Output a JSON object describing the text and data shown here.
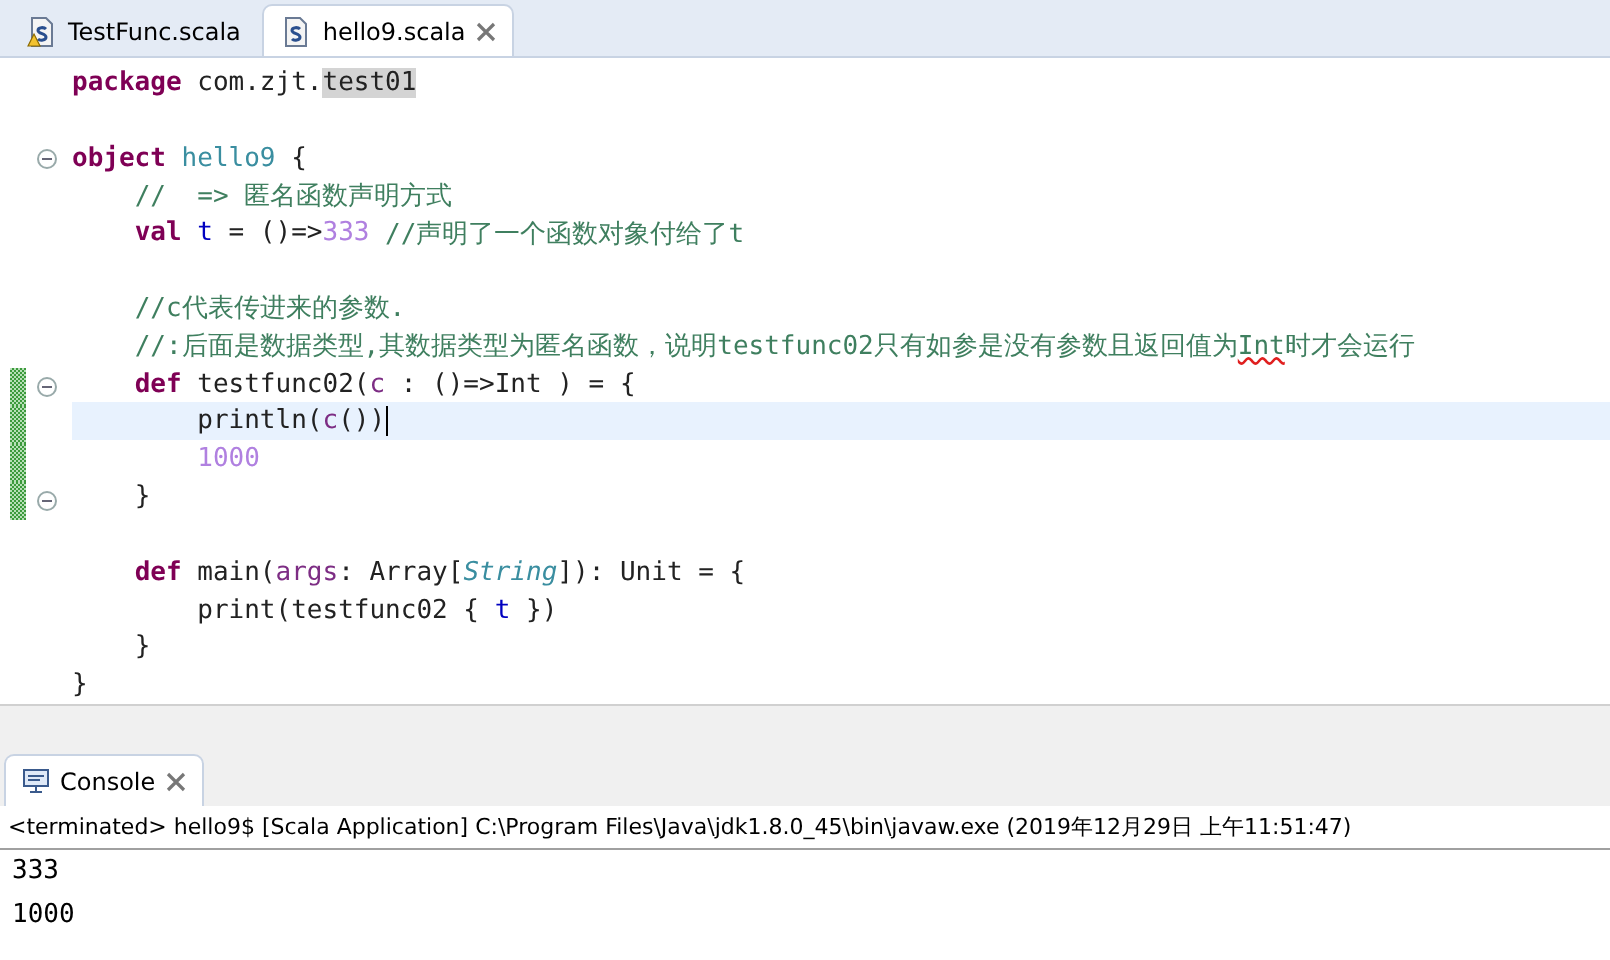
{
  "editor_tabs": [
    {
      "label": "TestFunc.scala",
      "selected": false,
      "warning": true,
      "closable": false
    },
    {
      "label": "hello9.scala",
      "selected": true,
      "warning": false,
      "closable": true
    }
  ],
  "code_lines": [
    {
      "kind": "code",
      "fold": false,
      "changed": false,
      "current": false,
      "tokens": [
        {
          "kind": "keyword",
          "text": "package"
        },
        {
          "kind": "plain",
          "text": " com.zjt."
        },
        {
          "kind": "occurrence",
          "text": "test01"
        }
      ]
    },
    {
      "kind": "blank"
    },
    {
      "kind": "code",
      "fold": true,
      "changed": false,
      "current": false,
      "tokens": [
        {
          "kind": "keyword",
          "text": "object"
        },
        {
          "kind": "object",
          "text": " hello9"
        },
        {
          "kind": "plain",
          "text": " {"
        }
      ],
      "children": [
        {
          "kind": "code",
          "fold": false,
          "changed": false,
          "current": false,
          "tokens": [
            {
              "kind": "comment",
              "text": "//  => 匿名函数声明方式"
            }
          ]
        },
        {
          "kind": "code",
          "fold": false,
          "changed": false,
          "current": false,
          "tokens": [
            {
              "kind": "keyword",
              "text": "val"
            },
            {
              "kind": "field",
              "text": " t"
            },
            {
              "kind": "plain",
              "text": " = ()=>"
            },
            {
              "kind": "number",
              "text": "333"
            },
            {
              "kind": "comment",
              "text": " //声明了一个函数对象付给了t"
            }
          ]
        },
        {
          "kind": "blank"
        },
        {
          "kind": "code",
          "fold": false,
          "changed": false,
          "current": false,
          "tokens": [
            {
              "kind": "comment",
              "text": "//c代表传进来的参数."
            }
          ]
        },
        {
          "kind": "code",
          "fold": false,
          "changed": false,
          "current": false,
          "tokens": [
            {
              "kind": "comment",
              "text": "//:后面是数据类型,其数据类型为匿名函数，说明testfunc02只有如参是没有参数且返回值为"
            },
            {
              "kind": "misspelled",
              "text": "Int"
            },
            {
              "kind": "comment",
              "text": "时才会运行"
            }
          ]
        },
        {
          "kind": "code",
          "fold": true,
          "changed": true,
          "current": false,
          "tokens": [
            {
              "kind": "keyword",
              "text": "def"
            },
            {
              "kind": "plain",
              "text": " testfunc02("
            },
            {
              "kind": "param",
              "text": "c"
            },
            {
              "kind": "plain",
              "text": " : ()=>Int ) = {"
            }
          ],
          "children": [
            {
              "kind": "code",
              "fold": false,
              "changed": true,
              "current": true,
              "tokens": [
                {
                  "kind": "plain",
                  "text": "println("
                },
                {
                  "kind": "param",
                  "text": "c"
                },
                {
                  "kind": "plain",
                  "text": "())"
                }
              ]
            },
            {
              "kind": "code",
              "fold": false,
              "changed": true,
              "current": false,
              "tokens": [
                {
                  "kind": "number",
                  "text": "1000"
                }
              ]
            }
          ]
        },
        {
          "kind": "code",
          "fold": true,
          "changed": true,
          "current": false,
          "tokens": [
            {
              "kind": "plain",
              "text": "}"
            }
          ]
        },
        {
          "kind": "blank"
        },
        {
          "kind": "code",
          "fold": false,
          "changed": false,
          "current": false,
          "tokens": [
            {
              "kind": "keyword",
              "text": "def"
            },
            {
              "kind": "plain",
              "text": " main("
            },
            {
              "kind": "param",
              "text": "args"
            },
            {
              "kind": "plain",
              "text": ": Array["
            },
            {
              "kind": "type",
              "text": "String"
            },
            {
              "kind": "plain",
              "text": "]): Unit = {"
            }
          ],
          "children": [
            {
              "kind": "code",
              "fold": false,
              "changed": false,
              "current": false,
              "tokens": [
                {
                  "kind": "plain",
                  "text": "print(testfunc02 { "
                },
                {
                  "kind": "field",
                  "text": "t"
                },
                {
                  "kind": "plain",
                  "text": " })"
                }
              ]
            }
          ]
        },
        {
          "kind": "code",
          "fold": false,
          "changed": false,
          "current": false,
          "tokens": [
            {
              "kind": "plain",
              "text": "}"
            }
          ]
        }
      ]
    },
    {
      "kind": "code",
      "fold": false,
      "changed": false,
      "current": false,
      "tokens": [
        {
          "kind": "plain",
          "text": "}"
        }
      ]
    }
  ],
  "console": {
    "tab": {
      "label": "Console",
      "selected": true
    },
    "status": "<terminated> hello9$ [Scala Application] C:\\Program Files\\Java\\jdk1.8.0_45\\bin\\javaw.exe (2019年12月29日 上午11:51:47)",
    "output": [
      "333",
      "1000"
    ]
  }
}
